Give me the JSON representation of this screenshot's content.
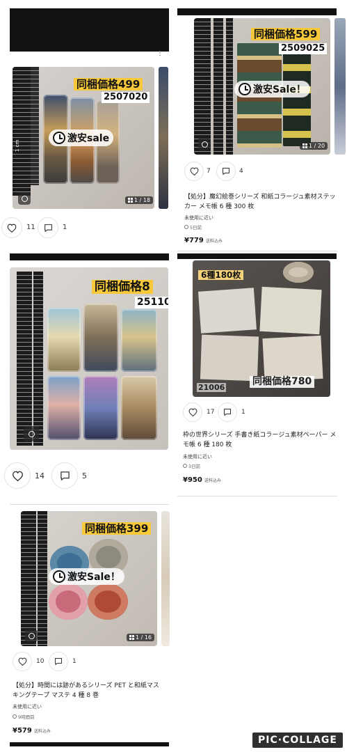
{
  "items": [
    {
      "promo": "同梱価格499",
      "code": "2507020",
      "sale": "激安sale",
      "photo_counter": "1 / 18",
      "likes": "11",
      "comments": "1"
    },
    {
      "promo": "同梱価格599",
      "code": "2509025",
      "sale": "激安Sale！",
      "photo_counter": "1 / 20",
      "likes": "7",
      "comments": "4",
      "title": "【処分】魔幻絵巻シリーズ 和紙コラージュ素材ステッカー メモ帳 6 種 300 枚",
      "condition": "未使用に近い",
      "posted": "5日前",
      "price": "¥779",
      "shipping": "送料込み"
    },
    {
      "promo": "同梱価格8",
      "code": "25110",
      "likes": "14",
      "comments": "5"
    },
    {
      "promo_top": "6種180枚",
      "promo": "同梱価格780",
      "code": "21006",
      "likes": "17",
      "comments": "1",
      "title": "枠の世界シリーズ 手書き紙コラージュ素材ペーパー メモ帳 6 種 180 枚",
      "condition": "未使用に近い",
      "posted": "3日前",
      "price": "¥950",
      "shipping": "送料込み"
    },
    {
      "promo": "同梱価格399",
      "sale": "激安Sale！",
      "photo_counter": "1 / 16",
      "likes": "10",
      "comments": "1",
      "title": "【処分】時間には跡があるシリーズ PET と和紙マスキングテープ マステ 4 種 8 巻",
      "condition": "未使用に近い",
      "posted": "9時間前",
      "price": "¥579",
      "shipping": "送料込み"
    }
  ],
  "ruler_label": "1 cm",
  "watermark": "PIC·COLLAGE",
  "icons": [
    "heart-icon",
    "comment-icon",
    "clock-icon",
    "lens-icon",
    "grid-icon",
    "more-icon"
  ],
  "colors": {
    "promo_yellow": "#f7c93a",
    "black_bar": "#111111",
    "watermark_bg": "#2f2f2f"
  }
}
